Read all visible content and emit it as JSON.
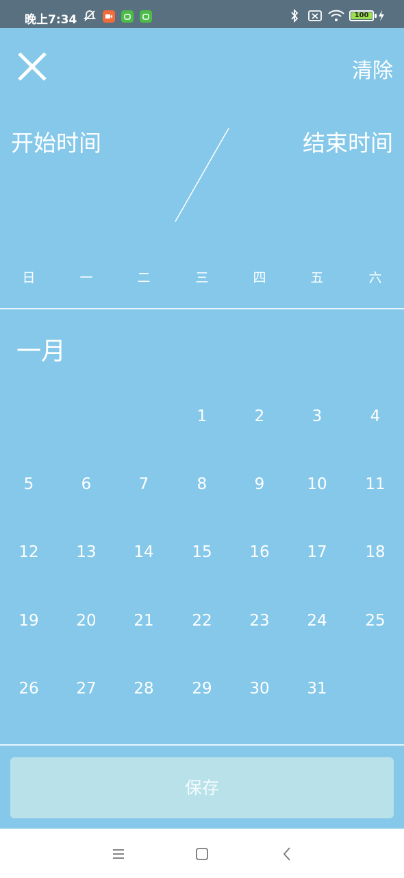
{
  "status_bar": {
    "time": "晚上7:34",
    "battery": "100",
    "icons": [
      "alarm-off-icon",
      "video-app-icon",
      "android-app-icon",
      "android-app-icon",
      "bluetooth-icon",
      "sim-off-icon",
      "wifi-icon",
      "battery-icon",
      "charging-icon"
    ],
    "colors": {
      "video_badge": "#F26B3A",
      "android_badge": "#4CBB48"
    }
  },
  "header": {
    "close_icon": "close-icon",
    "clear_label": "清除",
    "start_label": "开始时间",
    "end_label": "结束时间"
  },
  "weekdays": [
    "日",
    "一",
    "二",
    "三",
    "四",
    "五",
    "六"
  ],
  "month": {
    "title": "一月",
    "weeks": [
      [
        "",
        "",
        "",
        "1",
        "2",
        "3",
        "4"
      ],
      [
        "5",
        "6",
        "7",
        "8",
        "9",
        "10",
        "11"
      ],
      [
        "12",
        "13",
        "14",
        "15",
        "16",
        "17",
        "18"
      ],
      [
        "19",
        "20",
        "21",
        "22",
        "23",
        "24",
        "25"
      ],
      [
        "26",
        "27",
        "28",
        "29",
        "30",
        "31",
        ""
      ]
    ]
  },
  "footer": {
    "save_label": "保存"
  },
  "nav": [
    "menu-icon",
    "home-icon",
    "back-icon"
  ],
  "colors": {
    "background": "#85C8E9",
    "save_button": "#B8E1E9",
    "status_bar": "#58707F"
  }
}
